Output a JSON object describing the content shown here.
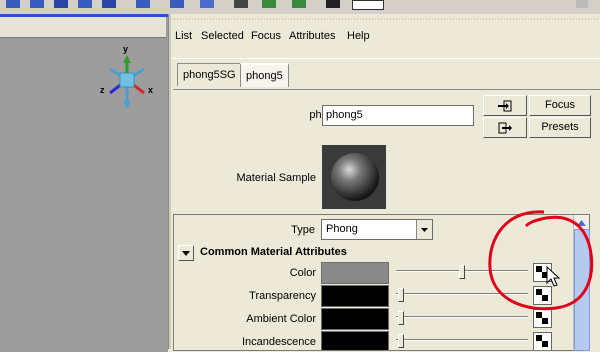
{
  "menu": {
    "items": [
      "List",
      "Selected",
      "Focus",
      "Attributes",
      "Help"
    ]
  },
  "tabs": [
    "phong5SG",
    "phong5"
  ],
  "selected_tab": "phong5",
  "node": {
    "type_label": "phong:",
    "name_value": "phong5"
  },
  "buttons": {
    "focus": "Focus",
    "presets": "Presets"
  },
  "material_sample_label": "Material Sample",
  "type_row": {
    "label": "Type",
    "value": "Phong"
  },
  "section": {
    "title": "Common Material Attributes"
  },
  "attributes": [
    {
      "label": "Color",
      "swatch": "#8a8a8a"
    },
    {
      "label": "Transparency",
      "swatch": "#000000"
    },
    {
      "label": "Ambient Color",
      "swatch": "#000000"
    },
    {
      "label": "Incandescence",
      "swatch": "#000000"
    }
  ],
  "slider_levels": [
    0.5,
    0.0,
    0.0,
    0.0
  ],
  "axes": {
    "y": "y",
    "x": "x",
    "z": "z"
  },
  "colors": {
    "annotation": "#e0001a",
    "viewport": "#9d9d9d",
    "panel": "#ece9d8"
  }
}
